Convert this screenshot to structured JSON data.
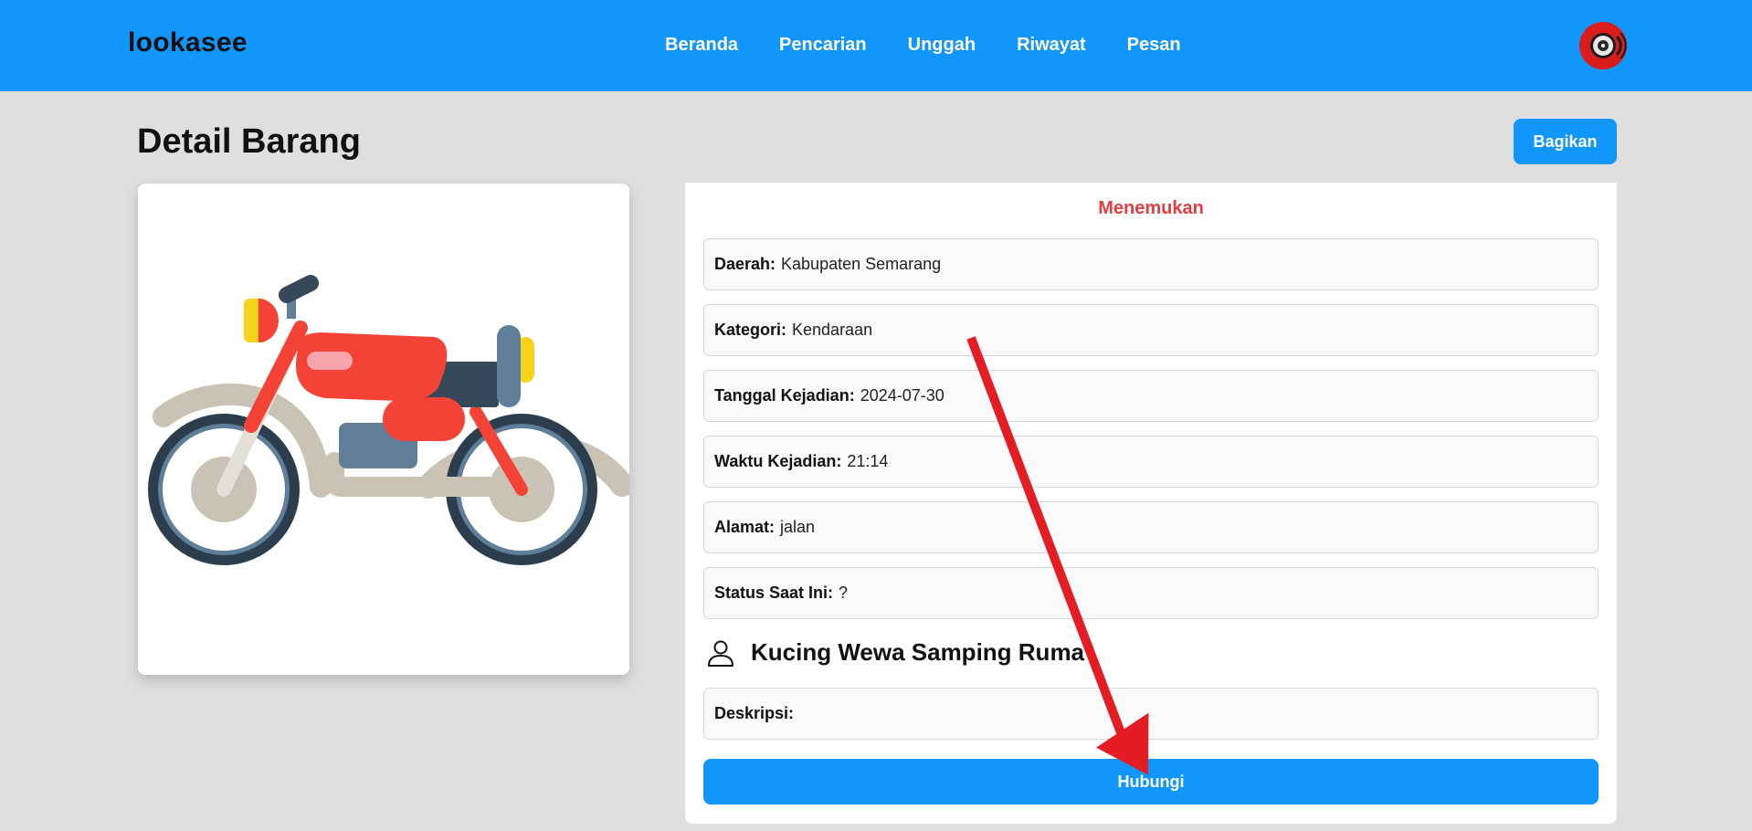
{
  "navbar": {
    "brand": "lookasee",
    "links": [
      {
        "label": "Beranda"
      },
      {
        "label": "Pencarian"
      },
      {
        "label": "Unggah"
      },
      {
        "label": "Riwayat"
      },
      {
        "label": "Pesan"
      }
    ],
    "avatar_icon": "vinyl-record-avatar-icon"
  },
  "page": {
    "title": "Detail Barang",
    "share_label": "Bagikan"
  },
  "item": {
    "image_icon": "motorcycle-icon",
    "status": "Menemukan",
    "fields": [
      {
        "key": "Daerah",
        "value": "Kabupaten Semarang"
      },
      {
        "key": "Kategori",
        "value": "Kendaraan"
      },
      {
        "key": "Tanggal Kejadian",
        "value": "2024-07-30"
      },
      {
        "key": "Waktu Kejadian",
        "value": "21:14"
      },
      {
        "key": "Alamat",
        "value": "jalan"
      },
      {
        "key": "Status Saat Ini",
        "value": "?"
      }
    ],
    "finder_name": "Kucing Wewa Samping Ruma",
    "description_key": "Deskripsi",
    "description_value": "",
    "contact_label": "Hubungi"
  },
  "colors": {
    "primary": "#1196fb",
    "status": "#e53d3d",
    "annotation_arrow": "#e41c23"
  }
}
